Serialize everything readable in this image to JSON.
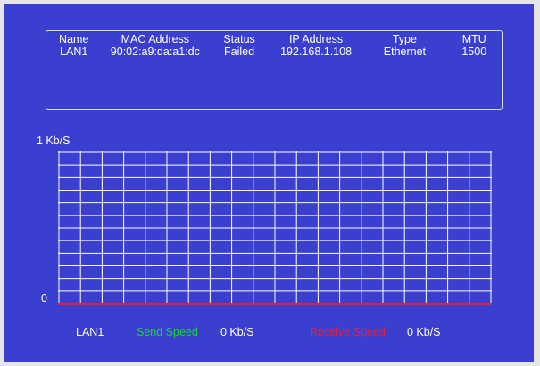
{
  "table": {
    "headers": {
      "name": "Name",
      "mac": "MAC Address",
      "status": "Status",
      "ip": "IP Address",
      "type": "Type",
      "mtu": "MTU"
    },
    "rows": [
      {
        "name": "LAN1",
        "mac": "90:02:a9:da:a1:dc",
        "status": "Failed",
        "ip": "192.168.1.108",
        "type": "Ethernet",
        "mtu": "1500"
      }
    ]
  },
  "chart": {
    "y_max_label": "1 Kb/S",
    "y_min_label": "0"
  },
  "legend": {
    "interface": "LAN1",
    "send_label": "Send Speed",
    "send_value": "0 Kb/S",
    "receive_label": "Receive Speed",
    "receive_value": "0 Kb/S"
  },
  "colors": {
    "background": "#3a3fd0",
    "grid": "#ffffff",
    "send": "#1fd33a",
    "receive": "#e0203c"
  },
  "chart_data": {
    "type": "line",
    "title": "",
    "ylabel": "",
    "xlabel": "",
    "ylim": [
      0,
      1
    ],
    "grid": true,
    "series": [
      {
        "name": "Send Speed",
        "values": [
          0
        ]
      },
      {
        "name": "Receive Speed",
        "values": [
          0
        ]
      }
    ]
  }
}
